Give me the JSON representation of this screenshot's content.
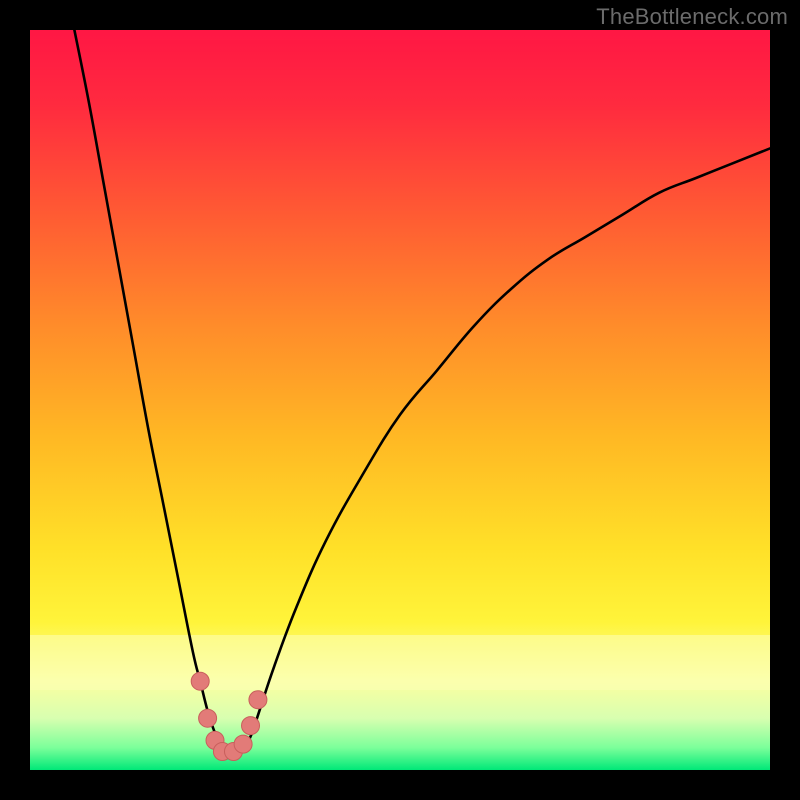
{
  "watermark": "TheBottleneck.com",
  "colors": {
    "frame": "#000000",
    "curve": "#000000",
    "marker_fill": "#e27b78",
    "marker_stroke": "#c85f5c",
    "gradient_stops": [
      {
        "offset": 0.0,
        "color": "#ff1744"
      },
      {
        "offset": 0.1,
        "color": "#ff2a3f"
      },
      {
        "offset": 0.25,
        "color": "#ff5b33"
      },
      {
        "offset": 0.4,
        "color": "#ff8c2a"
      },
      {
        "offset": 0.55,
        "color": "#ffb824"
      },
      {
        "offset": 0.7,
        "color": "#ffe028"
      },
      {
        "offset": 0.8,
        "color": "#fff43a"
      },
      {
        "offset": 0.88,
        "color": "#fbffa0"
      },
      {
        "offset": 0.93,
        "color": "#d8ffb0"
      },
      {
        "offset": 0.97,
        "color": "#7bff9a"
      },
      {
        "offset": 1.0,
        "color": "#00e878"
      }
    ]
  },
  "chart_data": {
    "type": "line",
    "title": "",
    "xlabel": "",
    "ylabel": "",
    "xlim": [
      0,
      100
    ],
    "ylim": [
      0,
      100
    ],
    "note": "x is a normalized horizontal parameter; y is bottleneck percentage (0 at bottom = no bottleneck, 100 at top = full bottleneck). Background color maps to y: green near 0, red near 100.",
    "series": [
      {
        "name": "bottleneck-curve",
        "x": [
          6,
          8,
          10,
          12,
          14,
          16,
          18,
          20,
          22,
          23,
          24,
          25,
          26,
          27,
          28,
          29,
          30,
          31,
          33,
          36,
          40,
          45,
          50,
          55,
          60,
          65,
          70,
          75,
          80,
          85,
          90,
          95,
          100
        ],
        "y": [
          100,
          90,
          79,
          68,
          57,
          46,
          36,
          26,
          16,
          12,
          8,
          5,
          3,
          2,
          2,
          3,
          5,
          8,
          14,
          22,
          31,
          40,
          48,
          54,
          60,
          65,
          69,
          72,
          75,
          78,
          80,
          82,
          84
        ]
      }
    ],
    "markers": {
      "name": "highlighted-points",
      "x": [
        23.0,
        24.0,
        25.0,
        26.0,
        27.5,
        28.8,
        29.8,
        30.8
      ],
      "y": [
        12.0,
        7.0,
        4.0,
        2.5,
        2.5,
        3.5,
        6.0,
        9.5
      ]
    }
  }
}
